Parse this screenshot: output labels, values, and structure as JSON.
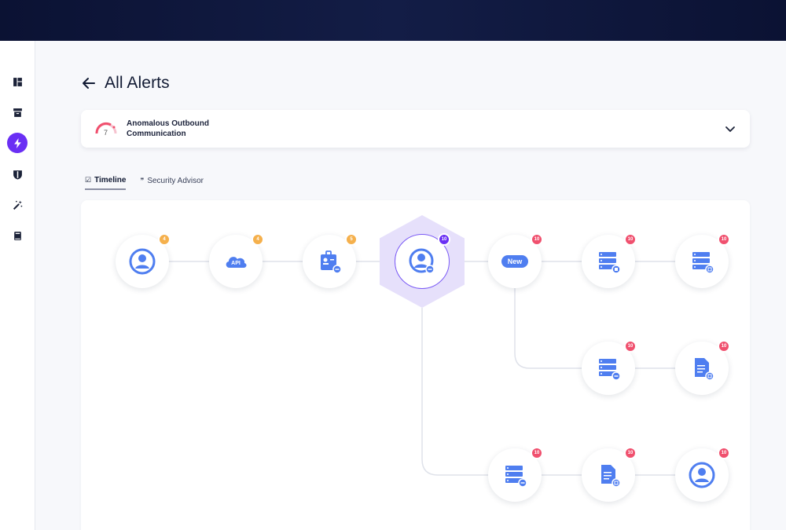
{
  "header": {
    "title": "All Alerts"
  },
  "alert": {
    "name": "Anomalous Outbound Communication",
    "score": "7"
  },
  "tabs": [
    {
      "label": "Timeline",
      "glyph": "☑"
    },
    {
      "label": "Security Advisor",
      "glyph": "❞"
    }
  ],
  "sidebar": {
    "items": [
      {
        "icon": "dashboard-icon"
      },
      {
        "icon": "archive-icon"
      },
      {
        "icon": "lightning-icon",
        "active": true
      },
      {
        "icon": "shield-icon"
      },
      {
        "icon": "magic-wand-icon"
      },
      {
        "icon": "book-icon"
      }
    ]
  },
  "nodes": [
    {
      "id": "n1",
      "icon": "user-icon",
      "badge": "4",
      "badge_color": "orange"
    },
    {
      "id": "n2",
      "icon": "api-cloud-icon",
      "label": "API",
      "badge": "4",
      "badge_color": "orange"
    },
    {
      "id": "n3",
      "icon": "id-card-icon",
      "badge": "5",
      "badge_color": "orange"
    },
    {
      "id": "n4",
      "icon": "user-icon",
      "badge": "10",
      "badge_color": "purple",
      "focused": true
    },
    {
      "id": "n5",
      "icon": "new-pill",
      "label": "New",
      "badge": "10",
      "badge_color": "red"
    },
    {
      "id": "n6",
      "icon": "server-icon",
      "badge": "10",
      "badge_color": "red"
    },
    {
      "id": "n7",
      "icon": "server-icon",
      "badge": "10",
      "badge_color": "red"
    },
    {
      "id": "n8",
      "icon": "server-icon",
      "badge": "10",
      "badge_color": "red"
    },
    {
      "id": "n9",
      "icon": "document-icon",
      "badge": "10",
      "badge_color": "red"
    },
    {
      "id": "n10",
      "icon": "server-icon",
      "badge": "10",
      "badge_color": "red"
    },
    {
      "id": "n11",
      "icon": "document-icon",
      "badge": "10",
      "badge_color": "red"
    },
    {
      "id": "n12",
      "icon": "user-icon",
      "badge": "10",
      "badge_color": "red"
    }
  ],
  "colors": {
    "accent": "#6a2ff4",
    "icon_blue": "#4f7ef0",
    "badge_orange": "#f5b04c",
    "badge_red": "#f0506e"
  }
}
